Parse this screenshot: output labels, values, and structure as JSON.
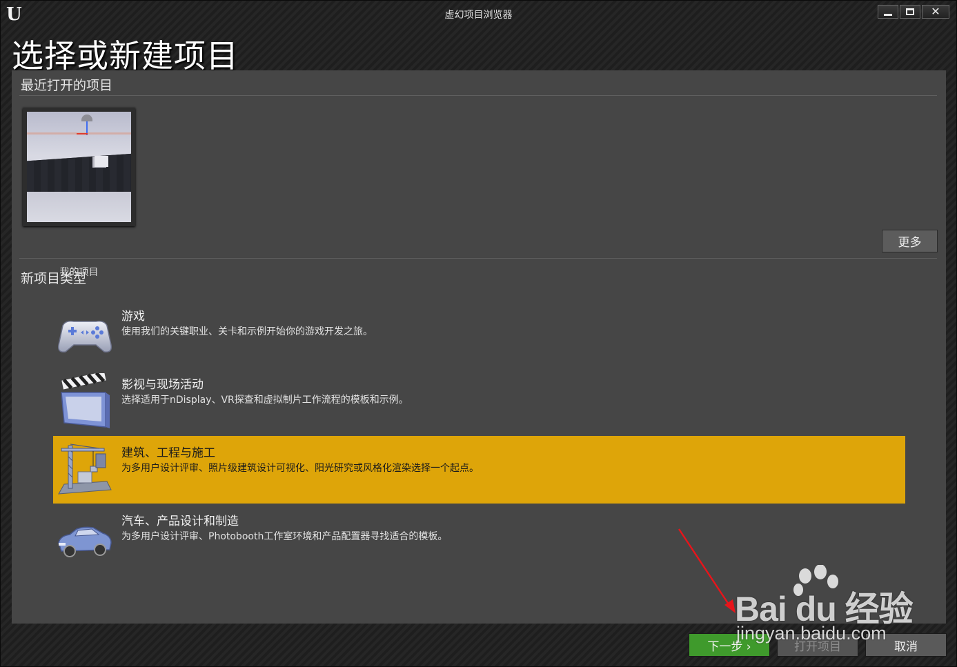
{
  "window": {
    "title": "虚幻项目浏览器",
    "logo": "U"
  },
  "page": {
    "title": "选择或新建项目"
  },
  "recent": {
    "section_title": "最近打开的项目",
    "projects": [
      {
        "name": "我的项目"
      }
    ],
    "more_label": "更多"
  },
  "new_project": {
    "section_title": "新项目类型",
    "types": [
      {
        "title": "游戏",
        "description": "使用我们的关键职业、关卡和示例开始你的游戏开发之旅。",
        "icon": "gamepad-icon",
        "selected": false
      },
      {
        "title": "影视与现场活动",
        "description": "选择适用于nDisplay、VR探查和虚拟制片工作流程的模板和示例。",
        "icon": "clapperboard-icon",
        "selected": false
      },
      {
        "title": "建筑、工程与施工",
        "description": "为多用户设计评审、照片级建筑设计可视化、阳光研究或风格化渲染选择一个起点。",
        "icon": "crane-icon",
        "selected": true
      },
      {
        "title": "汽车、产品设计和制造",
        "description": "为多用户设计评审、Photobooth工作室环境和产品配置器寻找适合的模板。",
        "icon": "car-icon",
        "selected": false
      }
    ]
  },
  "footer": {
    "next_label": "下一步 ›",
    "open_label": "打开项目",
    "cancel_label": "取消"
  },
  "watermark": {
    "logo_text": "Bai du 经验",
    "url": "jingyan.baidu.com"
  },
  "colors": {
    "selected_row": "#dea509",
    "next_button": "#3f9a2c",
    "panel": "#464646"
  }
}
